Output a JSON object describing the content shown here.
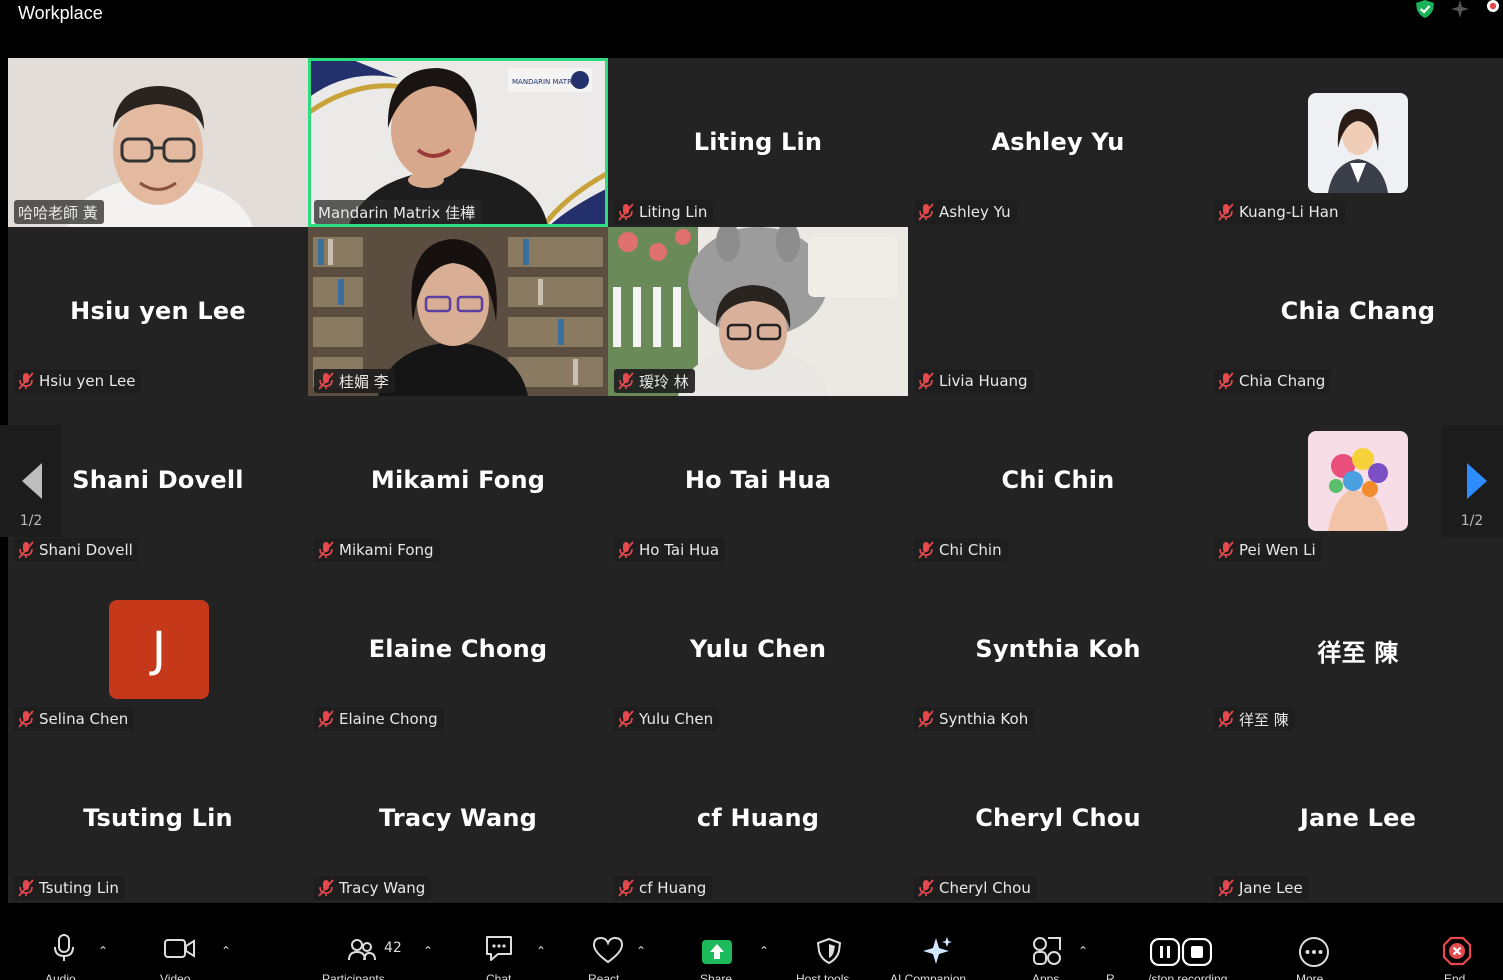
{
  "app": {
    "title": "Workplace"
  },
  "participants": [
    {
      "name": "哈哈老師 黃",
      "display": "",
      "mic_muted": false,
      "video": "video"
    },
    {
      "name": "Mandarin Matrix 佳樺",
      "display": "",
      "mic_muted": false,
      "video": "video",
      "active_speaker": true
    },
    {
      "name": "Liting Lin",
      "display": "Liting Lin",
      "mic_muted": true,
      "video": "name"
    },
    {
      "name": "Ashley Yu",
      "display": "Ashley Yu",
      "mic_muted": true,
      "video": "name"
    },
    {
      "name": "Kuang-Li Han",
      "display": "",
      "mic_muted": true,
      "video": "avatar-photo"
    },
    {
      "name": "Hsiu yen Lee",
      "display": "Hsiu yen Lee",
      "mic_muted": true,
      "video": "name"
    },
    {
      "name": "桂媚 李",
      "display": "",
      "mic_muted": true,
      "video": "video"
    },
    {
      "name": "瑷玲 林",
      "display": "",
      "mic_muted": true,
      "video": "video"
    },
    {
      "name": "Livia Huang",
      "display": "",
      "mic_muted": true,
      "video": "blank"
    },
    {
      "name": "Chia Chang",
      "display": "Chia Chang",
      "mic_muted": true,
      "video": "name"
    },
    {
      "name": "Shani Dovell",
      "display": "Shani Dovell",
      "mic_muted": true,
      "video": "name"
    },
    {
      "name": "Mikami Fong",
      "display": "Mikami Fong",
      "mic_muted": true,
      "video": "name"
    },
    {
      "name": "Ho Tai Hua",
      "display": "Ho Tai Hua",
      "mic_muted": true,
      "video": "name"
    },
    {
      "name": "Chi Chin",
      "display": "Chi Chin",
      "mic_muted": true,
      "video": "name"
    },
    {
      "name": "Pei Wen Li",
      "display": "",
      "mic_muted": true,
      "video": "avatar-flowers"
    },
    {
      "name": "Selina Chen",
      "display": "J",
      "mic_muted": true,
      "video": "avatar-letter"
    },
    {
      "name": "Elaine Chong",
      "display": "Elaine Chong",
      "mic_muted": true,
      "video": "name"
    },
    {
      "name": "Yulu Chen",
      "display": "Yulu Chen",
      "mic_muted": true,
      "video": "name"
    },
    {
      "name": "Synthia Koh",
      "display": "Synthia Koh",
      "mic_muted": true,
      "video": "name"
    },
    {
      "name": "徉至 陳",
      "display": "徉至 陳",
      "mic_muted": true,
      "video": "name"
    },
    {
      "name": "Tsuting Lin",
      "display": "Tsuting Lin",
      "mic_muted": true,
      "video": "name"
    },
    {
      "name": "Tracy Wang",
      "display": "Tracy Wang",
      "mic_muted": true,
      "video": "name"
    },
    {
      "name": "cf Huang",
      "display": "cf Huang",
      "mic_muted": true,
      "video": "name"
    },
    {
      "name": "Cheryl Chou",
      "display": "Cheryl Chou",
      "mic_muted": true,
      "video": "name"
    },
    {
      "name": "Jane Lee",
      "display": "Jane Lee",
      "mic_muted": true,
      "video": "name"
    }
  ],
  "pager": {
    "left_count": "1/2",
    "right_count": "1/2"
  },
  "toolbar": {
    "audio": "Audio",
    "video": "Video",
    "participants": "Participants",
    "participants_count": "42",
    "chat": "Chat",
    "react": "React",
    "share": "Share",
    "host_tools": "Host tools",
    "ai_companion": "AI Companion",
    "apps": "Apps",
    "record": "R",
    "pause_stop": "/stop recording",
    "more": "More",
    "end": "End"
  },
  "colors": {
    "active_speaker": "#2ddc7e",
    "mic_muted": "#e5484d",
    "tile_bg": "#232323",
    "avatar_letter_bg": "#c5381a",
    "share_button": "#1dba5b",
    "pager_arrow_right": "#2d8cff"
  }
}
